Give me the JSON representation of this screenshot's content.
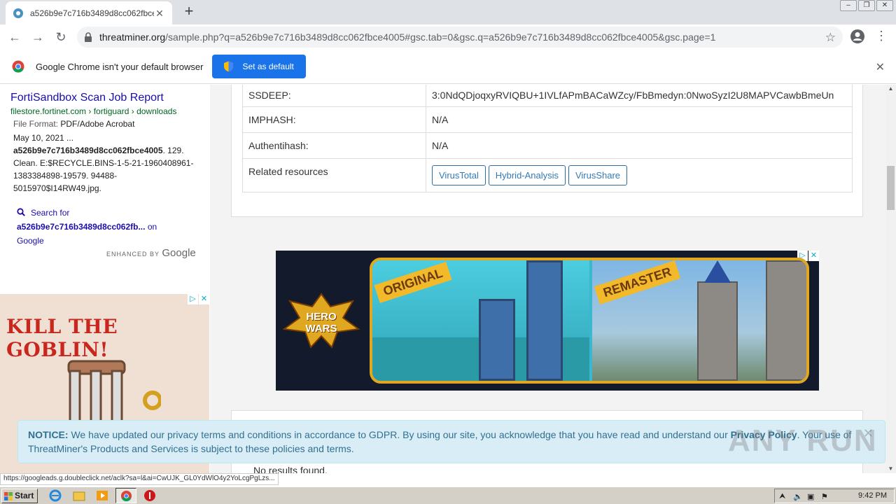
{
  "browser": {
    "tab_title": "a526b9e7c716b3489d8cc062fbce40",
    "url_host": "threatminer.org",
    "url_path": "/sample.php?q=a526b9e7c716b3489d8cc062fbce4005#gsc.tab=0&gsc.q=a526b9e7c716b3489d8cc062fbce4005&gsc.page=1"
  },
  "infobar": {
    "text": "Google Chrome isn't your default browser",
    "button_label": "Set as default"
  },
  "search_result": {
    "title": "FortiSandbox Scan Job Report",
    "url": "filestore.fortinet.com › fortiguard › downloads",
    "format_label": "File Format:",
    "format_value": "PDF/Adobe Acrobat",
    "date": "May 10, 2021 ...",
    "snippet_bold": "a526b9e7c716b3489d8cc062fbce4005",
    "snippet_rest": ". 129. Clean. E:$RECYCLE.BINS-1-5-21-1960408961-1383384898-19579. 94488-5015970$I14RW49.jpg.",
    "search_for_label": "Search for",
    "search_for_query": "a526b9e7c716b3489d8cc062fb...",
    "search_for_on": "on",
    "search_for_site": "Google",
    "enhanced_by": "ENHANCED BY",
    "enhanced_brand": "Google"
  },
  "left_ad": {
    "headline": "KILL THE GOBLIN!"
  },
  "details_table": [
    {
      "key": "SSDEEP:",
      "value": "3:0NdQDjoqxyRVIQBU+1IVLfAPmBACaWZcy/FbBmedyn:0NwoSyzI2U8MAPVCawbBmeUn"
    },
    {
      "key": "IMPHASH:",
      "value": "N/A"
    },
    {
      "key": "Authentihash:",
      "value": "N/A"
    },
    {
      "key": "Related resources",
      "value": ""
    }
  ],
  "resources": [
    "VirusTotal",
    "Hybrid-Analysis",
    "VirusShare"
  ],
  "banner_ad": {
    "logo_line1": "HERO",
    "logo_line2": "WARS",
    "left_label": "ORIGINAL",
    "right_label": "REMASTER"
  },
  "lower_card": {
    "text": "No results found."
  },
  "notice": {
    "label": "NOTICE:",
    "text_before": " We have updated our privacy terms and conditions in accordance to GDPR. By using our site, you acknowledge that you have read and understand our ",
    "link": "Privacy Policy",
    "text_after": ". Your use of ThreatMiner's Products and Services is subject to these policies and terms."
  },
  "watermark": "ANY RUN",
  "status_url": "https://googleads.g.doubleclick.net/aclk?sa=l&ai=CwUJK_GL0YdWlO4y2YoLcgPgLzs...",
  "taskbar": {
    "start_label": "Start",
    "clock": "9:42 PM"
  },
  "colors": {
    "chrome_blue": "#1a73e8",
    "link_blue": "#1a0dab",
    "url_green": "#006621",
    "notice_bg": "#d9edf7",
    "notice_text": "#31708f"
  }
}
